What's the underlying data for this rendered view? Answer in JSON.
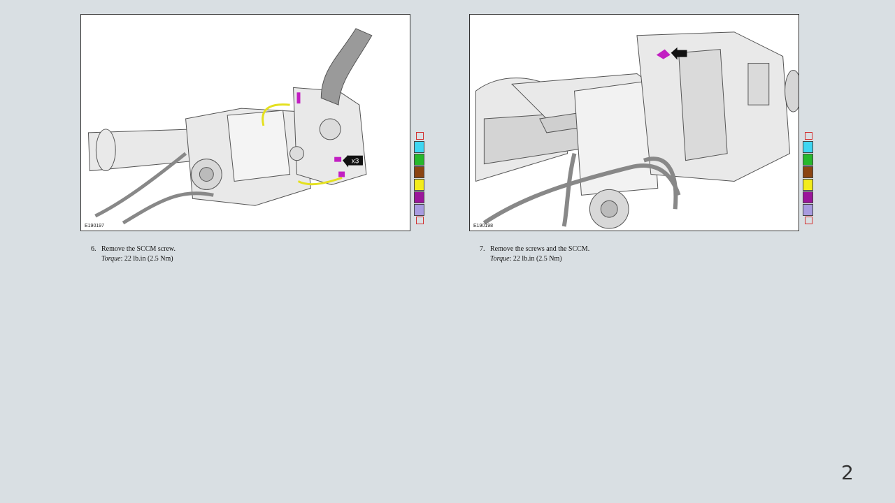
{
  "figures": [
    {
      "code": "E190197",
      "callout": "x3",
      "step_number": "6.",
      "instruction": "Remove the SCCM screw.",
      "torque_label": "Torque",
      "torque_value": ": 22 lb.in (2.5 Nm)"
    },
    {
      "code": "E190198",
      "step_number": "7.",
      "instruction": "Remove the screws and the SCCM.",
      "torque_label": "Torque",
      "torque_value": ": 22 lb.in (2.5 Nm)"
    }
  ],
  "palette_colors": [
    "#3fd6f2",
    "#26b82c",
    "#8b4513",
    "#f3ec1b",
    "#9b169b",
    "#a89be0"
  ],
  "highlight_colors": {
    "yellow": "#e4e020",
    "magenta": "#c21fc2"
  },
  "page_number": "2"
}
